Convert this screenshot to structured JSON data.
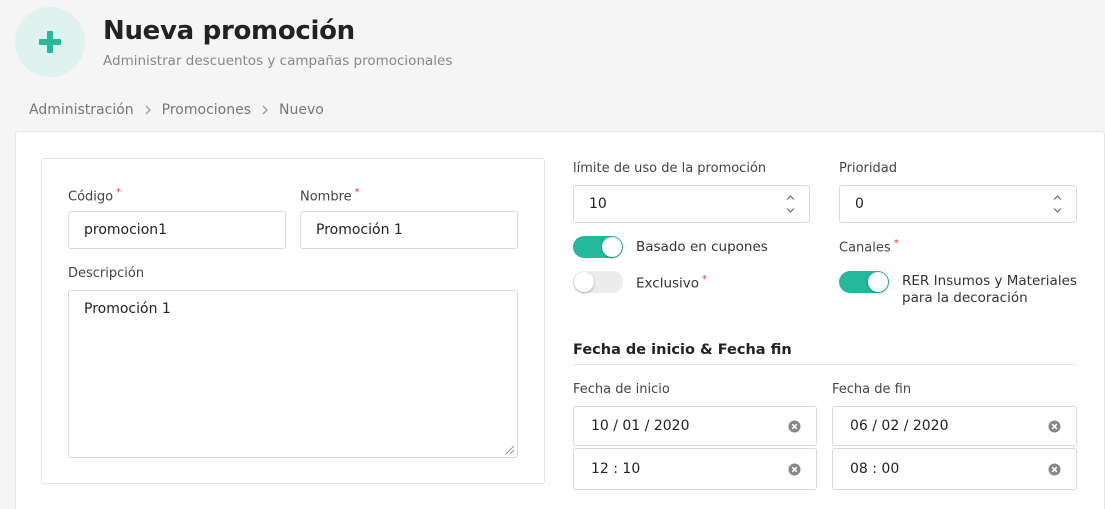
{
  "header": {
    "title": "Nueva promoción",
    "subtitle": "Administrar descuentos y campañas promocionales",
    "icon": "plus-icon",
    "accent": "#26b89a"
  },
  "breadcrumb": [
    "Administración",
    "Promociones",
    "Nuevo"
  ],
  "form": {
    "codigo": {
      "label": "Código",
      "value": "promocion1",
      "required": true
    },
    "nombre": {
      "label": "Nombre",
      "value": "Promoción 1",
      "required": true
    },
    "descripcion": {
      "label": "Descripción",
      "value": "Promoción 1"
    },
    "limite": {
      "label": "límite de uso de la promoción",
      "value": "10"
    },
    "prioridad": {
      "label": "Prioridad",
      "value": "0"
    },
    "basado_cupones": {
      "label": "Basado en cupones",
      "on": true
    },
    "exclusivo": {
      "label": "Exclusivo",
      "on": false,
      "required": true
    },
    "canales": {
      "label": "Canales",
      "required": true,
      "channel_line1": "RER Insumos y Materiales",
      "channel_line2": "para la decoración",
      "on": true
    },
    "fechas": {
      "section_title": "Fecha de inicio & Fecha fin",
      "inicio_label": "Fecha de inicio",
      "fin_label": "Fecha de fin",
      "inicio_date": "10 / 01 / 2020",
      "inicio_time": "12 : 10",
      "fin_date": "06 / 02 / 2020",
      "fin_time": "08 : 00"
    }
  }
}
